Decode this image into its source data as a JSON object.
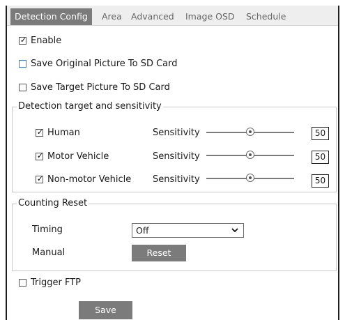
{
  "tabs": [
    {
      "label": "Detection Config",
      "active": true
    },
    {
      "label": "Area",
      "active": false
    },
    {
      "label": "Advanced",
      "active": false
    },
    {
      "label": "Image OSD",
      "active": false
    },
    {
      "label": "Schedule",
      "active": false
    }
  ],
  "options": {
    "enable": {
      "label": "Enable",
      "checked": true
    },
    "save_original": {
      "label": "Save Original Picture To SD Card",
      "checked": false
    },
    "save_target": {
      "label": "Save Target Picture To SD Card",
      "checked": false
    },
    "trigger_ftp": {
      "label": "Trigger FTP",
      "checked": false
    }
  },
  "detection": {
    "legend": "Detection target and sensitivity",
    "sensitivity_label": "Sensitivity",
    "targets": [
      {
        "label": "Human",
        "checked": true,
        "value": "50",
        "level": 0.5
      },
      {
        "label": "Motor Vehicle",
        "checked": true,
        "value": "50",
        "level": 0.5
      },
      {
        "label": "Non-motor Vehicle",
        "checked": true,
        "value": "50",
        "level": 0.5
      }
    ]
  },
  "counting": {
    "legend": "Counting Reset",
    "timing_label": "Timing",
    "timing_value": "Off",
    "manual_label": "Manual",
    "reset_label": "Reset"
  },
  "save_label": "Save",
  "colors": {
    "tab_active": "#7b7b7b",
    "button_bg": "#7b7b7b",
    "checkbox_accent": "#3a7cc7"
  }
}
